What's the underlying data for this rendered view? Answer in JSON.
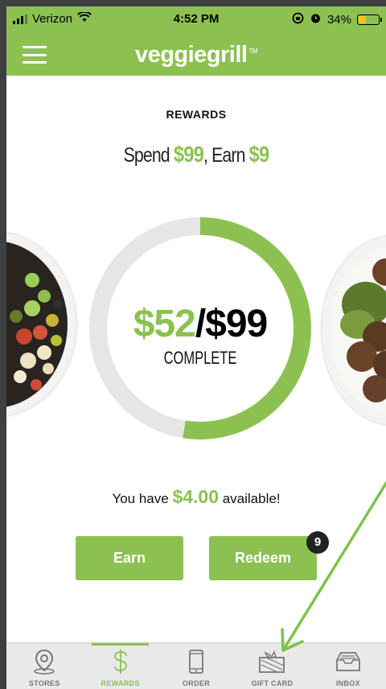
{
  "status_bar": {
    "carrier": "Verizon",
    "time": "4:52 PM",
    "battery": "34%"
  },
  "header": {
    "logo": "veggiegrill",
    "trademark": "TM"
  },
  "rewards": {
    "title": "REWARDS",
    "spend_prefix": "Spend ",
    "spend_amount": "$99",
    "spend_sep": ", Earn ",
    "earn_amount": "$9",
    "current": "$52",
    "slash_goal": "/$99",
    "complete_label": "COMPLETE",
    "progress_fraction": 0.525,
    "available_prefix": "You have ",
    "available_amount": "$4.00",
    "available_suffix": " available!"
  },
  "buttons": {
    "earn": "Earn",
    "redeem": "Redeem",
    "redeem_badge": "9"
  },
  "tabs": [
    {
      "label": "STORES",
      "icon": "map-pin-icon",
      "active": false
    },
    {
      "label": "REWARDS",
      "icon": "dollar-icon",
      "active": true
    },
    {
      "label": "ORDER",
      "icon": "phone-icon",
      "active": false
    },
    {
      "label": "GIFT CARD",
      "icon": "gift-card-icon",
      "active": false
    },
    {
      "label": "INBOX",
      "icon": "inbox-icon",
      "active": false
    }
  ],
  "colors": {
    "brand_green": "#8cc152",
    "ring_track": "#e7e6e4",
    "annotation_arrow": "#7ec24a"
  }
}
